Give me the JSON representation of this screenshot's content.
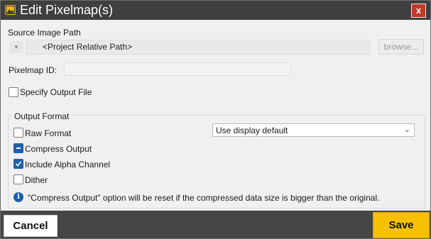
{
  "window": {
    "title": "Edit Pixelmap(s)",
    "close_label": "x"
  },
  "source": {
    "label": "Source Image Path",
    "path_value": "<Project Relative Path>",
    "browse_label": "browse..."
  },
  "pixelmap_id": {
    "label": "Pixelmap ID:",
    "value": ""
  },
  "specify_output": {
    "label": "Specify Output File",
    "checked": false
  },
  "output_format": {
    "title": "Output Format",
    "raw_format": {
      "label": "Raw Format",
      "checked": false
    },
    "compress_output": {
      "label": "Compress Output",
      "state": "indeterminate"
    },
    "include_alpha": {
      "label": "Include Alpha Channel",
      "checked": true
    },
    "dither": {
      "label": "Dither",
      "checked": false
    },
    "format_select": {
      "value": "Use display default"
    }
  },
  "info": {
    "message": "\"Compress Output\" option will be reset if the compressed data size is bigger than the original."
  },
  "footer": {
    "cancel_label": "Cancel",
    "save_label": "Save"
  },
  "colors": {
    "accent": "#1e5fae",
    "save": "#f7c101",
    "titlebar": "#3f3f3f",
    "close": "#c0392b"
  },
  "icons": {
    "title": "image-icon",
    "close": "close-icon",
    "info": "info-icon",
    "dropdown": "chevron-down-icon"
  }
}
